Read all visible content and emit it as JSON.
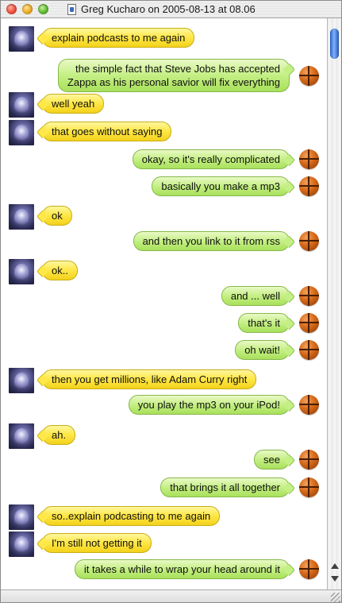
{
  "window": {
    "title": "Greg Kucharo on 2005-08-13 at 08.06"
  },
  "icons": {
    "left_avatar": "buddy-avatar-icon",
    "right_avatar": "basketball-icon"
  },
  "colors": {
    "left_bubble": "#ffe84a",
    "right_bubble": "#c4ef84"
  },
  "messages": [
    {
      "side": "left",
      "text": "explain podcasts to me again"
    },
    {
      "side": "right",
      "text": "the simple fact that Steve Jobs has accepted",
      "text2": "Zappa as his personal savior will fix everything"
    },
    {
      "side": "left",
      "text": "well yeah"
    },
    {
      "side": "left",
      "text": "that goes without saying"
    },
    {
      "side": "right",
      "text": "okay, so it's really complicated"
    },
    {
      "side": "right",
      "text": "basically you make a mp3"
    },
    {
      "side": "left",
      "text": "ok"
    },
    {
      "side": "right",
      "text": "and then you link to it from rss"
    },
    {
      "side": "left",
      "text": "ok.."
    },
    {
      "side": "right",
      "text": "and ... well"
    },
    {
      "side": "right",
      "text": "that's it"
    },
    {
      "side": "right",
      "text": "oh wait!"
    },
    {
      "side": "left",
      "text": "then you get millions, like Adam Curry right"
    },
    {
      "side": "right",
      "text": "you play the mp3 on your iPod!"
    },
    {
      "side": "left",
      "text": "ah."
    },
    {
      "side": "right",
      "text": "see"
    },
    {
      "side": "right",
      "text": "that brings it all together"
    },
    {
      "side": "left",
      "text": "so..explain podcasting to me again"
    },
    {
      "side": "left",
      "text": "I'm still not getting it"
    },
    {
      "side": "right",
      "text": "it takes a while to wrap your head around it"
    }
  ]
}
